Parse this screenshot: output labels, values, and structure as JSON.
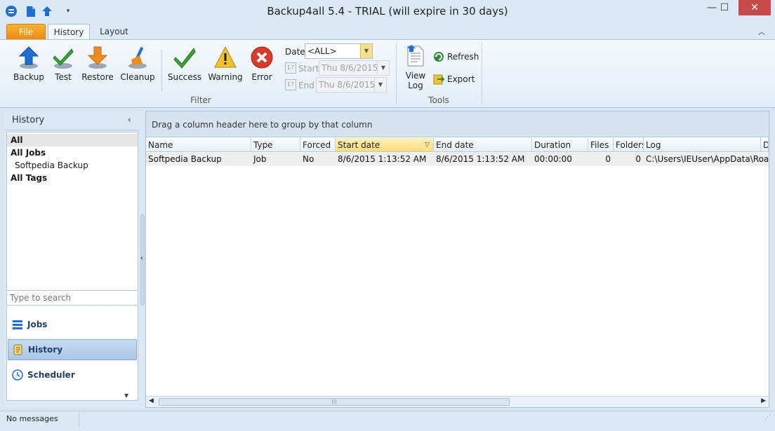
{
  "window": {
    "title": "Backup4all 5.4 - TRIAL (will expire in 30 days)",
    "minimize": "—",
    "maximize": "☐",
    "close": "✕"
  },
  "tabs": {
    "file": "File",
    "history": "History",
    "layout": "Layout"
  },
  "ribbon": {
    "backup": "Backup",
    "test": "Test",
    "restore": "Restore",
    "cleanup": "Cleanup",
    "success": "Success",
    "warning": "Warning",
    "error": "Error",
    "filter_group": "Filter",
    "date_label": "Date",
    "date_value": "<ALL>",
    "start_label": "Start",
    "start_value": "Thu 8/6/2015",
    "end_label": "End",
    "end_value": "Thu 8/6/2015",
    "view_log_1": "View",
    "view_log_2": "Log",
    "refresh": "Refresh",
    "export": "Export",
    "tools_group": "Tools"
  },
  "left": {
    "header": "History",
    "tree": [
      "All",
      "All Jobs",
      "Softpedia Backup",
      "All Tags"
    ],
    "search_placeholder": "Type to search",
    "nav": [
      "Jobs",
      "History",
      "Scheduler"
    ]
  },
  "grid": {
    "group_hint": "Drag a column header here to group by that column",
    "columns": [
      "Name",
      "Type",
      "Forced",
      "Start date",
      "End date",
      "Duration",
      "Files",
      "Folders",
      "Log",
      "D"
    ],
    "rows": [
      [
        "Softpedia Backup",
        "Job",
        "No",
        "8/6/2015 1:13:52 AM",
        "8/6/2015 1:13:52 AM",
        "00:00:00",
        "0",
        "0",
        "C:\\Users\\IEUser\\AppData\\Roan S"
      ]
    ]
  },
  "status": {
    "message": "No messages"
  },
  "colors": {
    "accent": "#1e6fd0",
    "file_tab": "#f3a024",
    "success": "#3aa335",
    "warning": "#f2c22e",
    "error": "#d93a2b"
  }
}
